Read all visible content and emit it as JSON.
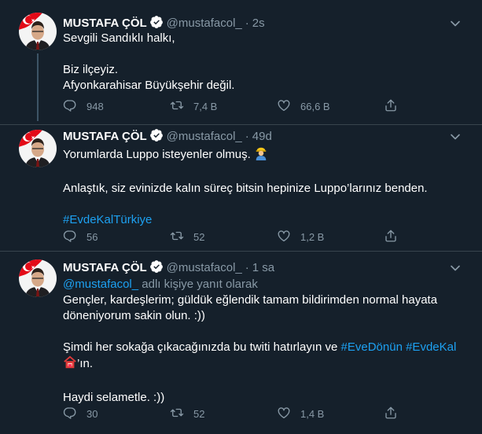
{
  "tweets": [
    {
      "name": "MUSTAFA ÇÖL",
      "handle": "@mustafacol_",
      "separator": "·",
      "time": "2s",
      "lines": [
        "Sevgili Sandıklı halkı,",
        "Biz ilçeyiz.",
        "Afyonkarahisar Büyükşehir değil."
      ],
      "actions": {
        "reply": "948",
        "retweet": "7,4 B",
        "like": "66,6 B"
      }
    },
    {
      "name": "MUSTAFA ÇÖL",
      "handle": "@mustafacol_",
      "separator": "·",
      "time": "49d",
      "lines": [
        "Yorumlarda Luppo isteyenler olmuş.",
        "Anlaştık, siz evinizde kalın süreç bitsin hepinize Luppo’larınız benden."
      ],
      "hashtag": "#EvdeKalTürkiye",
      "actions": {
        "reply": "56",
        "retweet": "52",
        "like": "1,2 B"
      }
    },
    {
      "name": "MUSTAFA ÇÖL",
      "handle": "@mustafacol_",
      "separator": "·",
      "time": "1 sa",
      "replying_mention": "@mustafacol_",
      "replying_text": "adlı kişiye yanıt olarak",
      "lines": [
        "Gençler, kardeşlerim; güldük eğlendik tamam bildirimden normal hayata döneniyorum sakin olun. :))",
        "Şimdi her sokağa çıkacağınızda bu twiti hatırlayın ve",
        "’ın.",
        "Haydi selametle.  :))"
      ],
      "hashtags": [
        "#EveDönün",
        "#EvdeKal"
      ],
      "actions": {
        "reply": "30",
        "retweet": "52",
        "like": "1,4 B"
      }
    }
  ],
  "icons": {
    "verified": "verified-badge-icon",
    "reply": "reply-icon",
    "retweet": "retweet-icon",
    "like": "heart-icon",
    "share": "share-icon",
    "caret": "chevron-down-icon"
  },
  "colors": {
    "background": "#15202b",
    "secondary_text": "#8899a6",
    "link": "#1da1f2",
    "divider": "#38444d"
  }
}
